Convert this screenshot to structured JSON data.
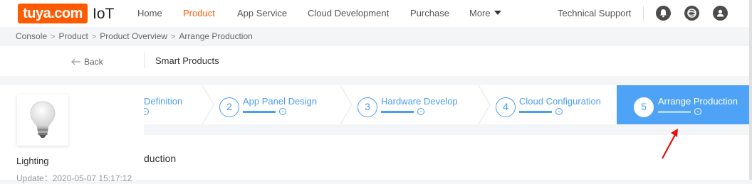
{
  "brand": {
    "logo_text": "tuya.com",
    "product_text": "IoT"
  },
  "nav": [
    "Home",
    "Product",
    "App Service",
    "Cloud Development",
    "Purchase",
    "More"
  ],
  "nav_active": "Product",
  "header": {
    "support_label": "Technical Support"
  },
  "icons": [
    "bell-icon",
    "globe-icon",
    "user-icon"
  ],
  "breadcrumb": [
    "Console",
    "Product",
    "Product Overview",
    "Arrange Production"
  ],
  "subheader": {
    "back_label": "Back",
    "title": "Smart Products"
  },
  "product_card": {
    "name": "Lighting",
    "update": "Update：2020-05-07 15:17:12"
  },
  "steps": [
    {
      "num": "",
      "label": "Definition"
    },
    {
      "num": "2",
      "label": "App Panel Design"
    },
    {
      "num": "3",
      "label": "Hardware Develop"
    },
    {
      "num": "4",
      "label": "Cloud Configuration"
    },
    {
      "num": "5",
      "label": "Arrange Production"
    }
  ],
  "active_step": 5,
  "content": {
    "title_visible": "duction"
  },
  "colors": {
    "brand": "#ff5a00",
    "accent": "#4c9df5",
    "active_step_bg": "#4fa3f7",
    "arrow": "#e8100a"
  }
}
